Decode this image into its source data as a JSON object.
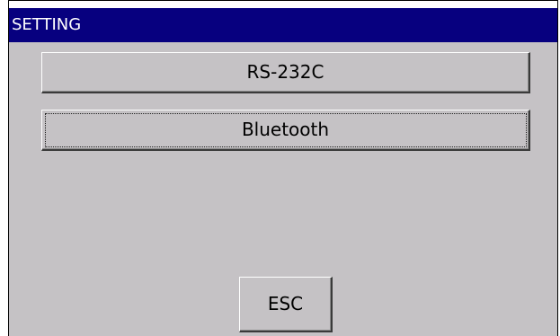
{
  "window": {
    "title": "SETTING"
  },
  "buttons": {
    "rs232c": "RS-232C",
    "bluetooth": "Bluetooth",
    "esc": "ESC"
  },
  "colors": {
    "titlebar": "#07007f",
    "background": "#c5c2c5",
    "title_text": "#ffffff"
  }
}
